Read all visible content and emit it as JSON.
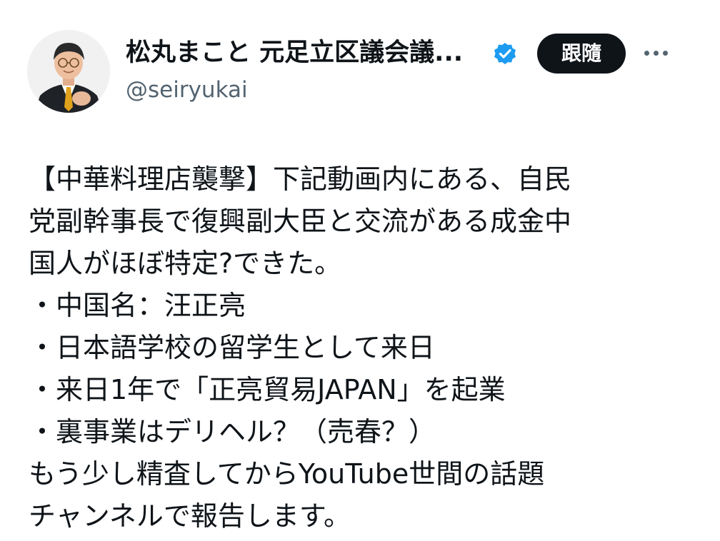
{
  "author": {
    "display_name": "松丸まこと 元足立区議会議...",
    "handle": "@seiryukai",
    "verified_icon": "verified-badge-icon",
    "accent": "#1d9bf0"
  },
  "actions": {
    "follow_label": "跟隨",
    "more_icon": "more-horizontal-icon"
  },
  "tweet": {
    "lines": [
      "【中華料理店襲撃】下記動画内にある、自民",
      "党副幹事長で復興副大臣と交流がある成金中",
      "国人がほぼ特定?できた。",
      "・中国名：汪正亮",
      "・日本語学校の留学生として来日",
      "・来日1年で「正亮貿易JAPAN」を起業",
      "・裏事業はデリヘル？（売春？）",
      "もう少し精査してからYouTube世間の話題",
      "チャンネルで報告します。"
    ]
  }
}
